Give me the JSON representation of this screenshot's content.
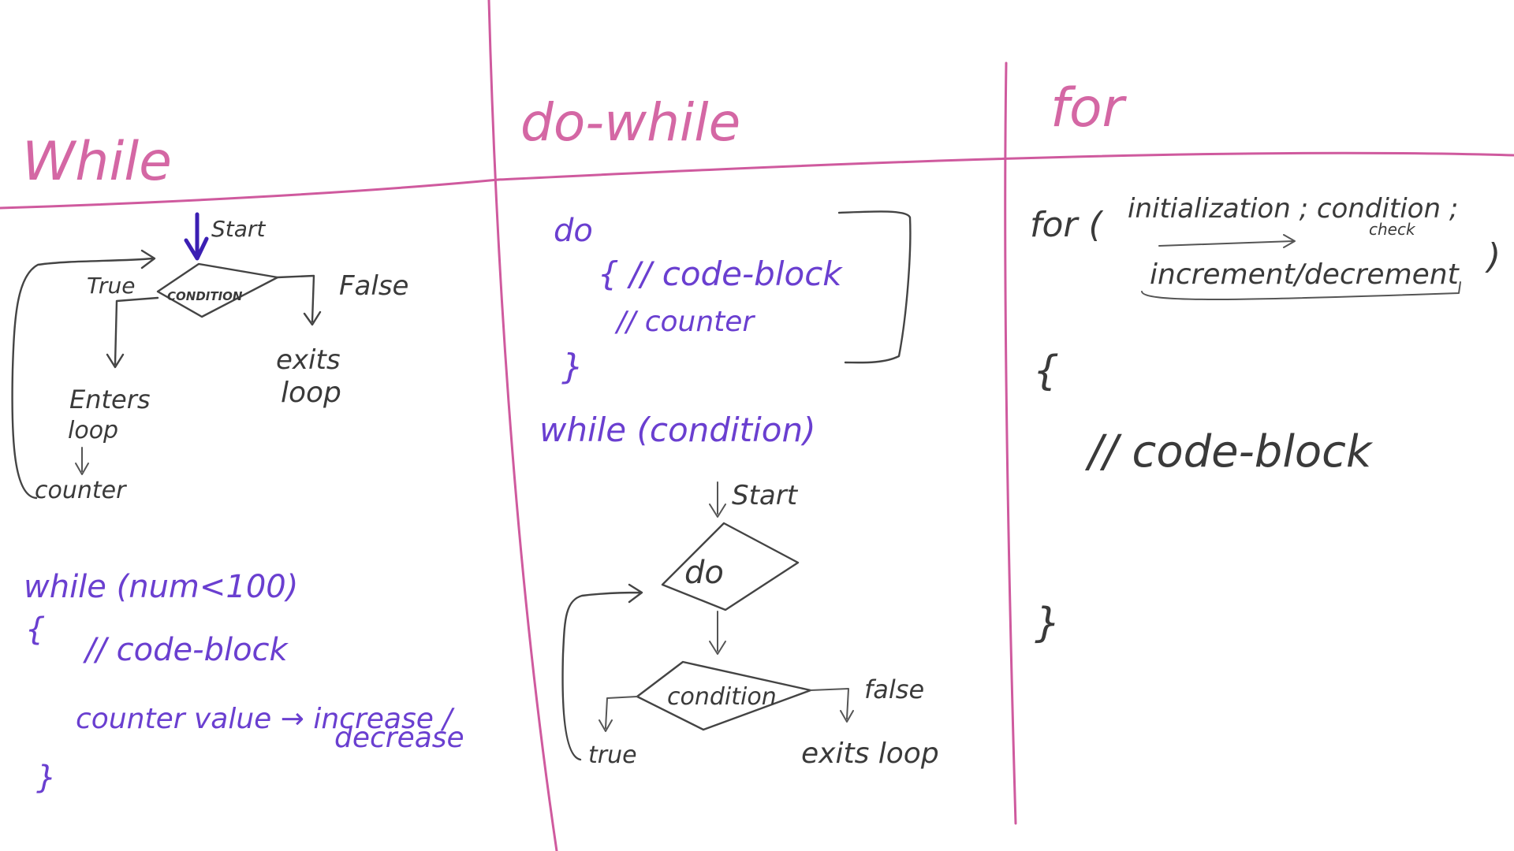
{
  "columns": [
    {
      "heading": "While",
      "flow": {
        "start": "Start",
        "condition": "CONDITION",
        "true_label": "True",
        "false_label": "False",
        "enters_1": "Enters",
        "enters_2": "loop",
        "counter": "counter",
        "exits_1": "exits",
        "exits_2": "loop"
      },
      "code": {
        "line1": "while (num<100)",
        "line2": "{",
        "line3": "// code-block",
        "line4": "counter value → increase /",
        "line5": "decrease",
        "line6": "}"
      }
    },
    {
      "heading": "do-while",
      "code": {
        "line1": "do",
        "line2": "{ // code-block",
        "line3": "// counter",
        "line4": "}",
        "line5": "while (condition)"
      },
      "flow": {
        "start": "Start",
        "do": "do",
        "condition": "condition",
        "false_label": "false",
        "true_label": "true",
        "exits": "exits loop"
      }
    },
    {
      "heading": "for",
      "code": {
        "line1_a": "for (",
        "line1_b": "initialization ; condition ;",
        "check": "check",
        "line2": "increment/decrement",
        "line2_close": ")",
        "open_brace": "{",
        "body": "// code-block",
        "close_brace": "}"
      }
    }
  ],
  "colors": {
    "heading": "#d467a4",
    "code": "#6a3fd0",
    "ink": "#3a3a3a",
    "divider": "#cf5a9e",
    "start_arrow": "#3b1fb3"
  }
}
